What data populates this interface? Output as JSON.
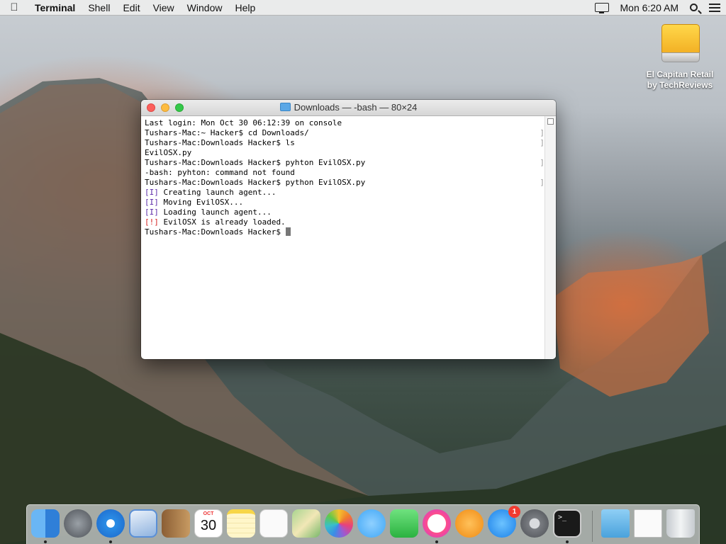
{
  "menubar": {
    "apple_icon": "apple-logo-icon",
    "items": [
      "Terminal",
      "Shell",
      "Edit",
      "View",
      "Window",
      "Help"
    ],
    "clock": "Mon 6:20 AM",
    "icons": [
      "display-icon",
      "search-icon",
      "list-icon"
    ]
  },
  "desktop": {
    "drive_label_line1": "El Capitan Retail",
    "drive_label_line2": "by TechReviews"
  },
  "window": {
    "title": "Downloads — -bash — 80×24",
    "lines": [
      {
        "text": "Last login: Mon Oct 30 06:12:39 on console"
      },
      {
        "text": "Tushars-Mac:~ Hacker$ cd Downloads/"
      },
      {
        "text": "Tushars-Mac:Downloads Hacker$ ls"
      },
      {
        "text": "EvilOSX.py"
      },
      {
        "text": "Tushars-Mac:Downloads Hacker$ pyhton EvilOSX.py"
      },
      {
        "text": "-bash: pyhton: command not found"
      },
      {
        "text": "Tushars-Mac:Downloads Hacker$ python EvilOSX.py"
      },
      {
        "tag": "[I]",
        "text": " Creating launch agent..."
      },
      {
        "tag": "[I]",
        "text": " Moving EvilOSX..."
      },
      {
        "tag": "[I]",
        "text": " Loading launch agent..."
      },
      {
        "tag": "[!]",
        "text": " EvilOSX is already loaded."
      },
      {
        "text": "Tushars-Mac:Downloads Hacker$ "
      }
    ]
  },
  "dock": {
    "calendar_month": "OCT",
    "calendar_day": "30",
    "appstore_badge": "1",
    "terminal_prompt": ">_",
    "colors": {
      "finder": "#3e8fe0",
      "launchpad": "#6c6f75",
      "safari": "#2a8de6",
      "mail": "#5a8fd6",
      "contacts": "#b98a55",
      "notes": "#f7d648",
      "reminders": "#fafafa",
      "maps": "#78b86a",
      "photos": "#fafafa",
      "messages": "#3fa6f5",
      "facetime": "#3bc54e",
      "itunes": "#ff4e8a",
      "ibooks": "#f59a1f",
      "appstore": "#2a93ee",
      "sysprefs": "#7a7d82",
      "terminal": "#1a1a1a",
      "downloads": "#5fb3ea",
      "document": "#fafafa",
      "trash": "#dfe3e6"
    }
  }
}
